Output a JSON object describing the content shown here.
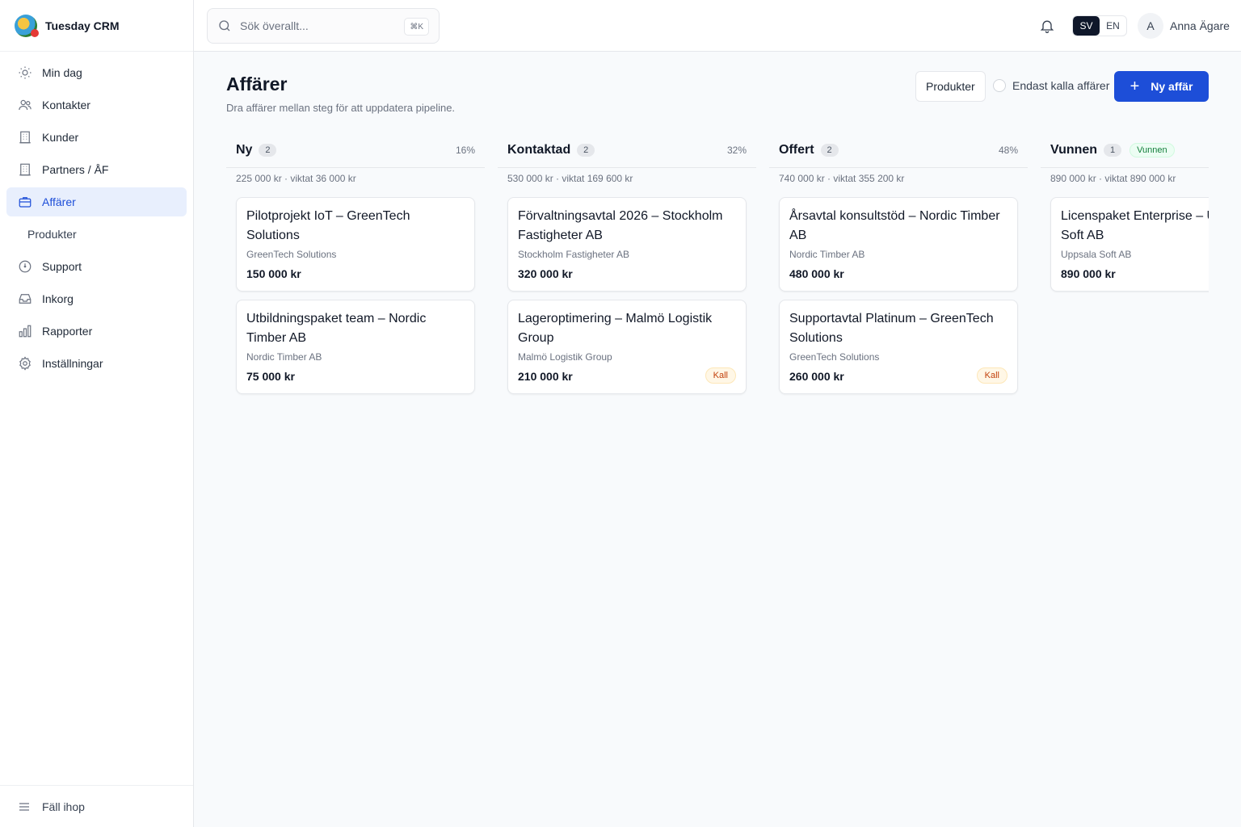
{
  "app": {
    "name": "Tuesday CRM"
  },
  "sidebar": {
    "items": [
      {
        "label": "Min dag"
      },
      {
        "label": "Kontakter"
      },
      {
        "label": "Kunder"
      },
      {
        "label": "Partners / ÅF"
      },
      {
        "label": "Affärer"
      },
      {
        "label": "Produkter"
      },
      {
        "label": "Support"
      },
      {
        "label": "Inkorg"
      },
      {
        "label": "Rapporter"
      },
      {
        "label": "Inställningar"
      }
    ],
    "collapse_label": "Fäll ihop"
  },
  "topbar": {
    "search_placeholder": "Sök överallt...",
    "search_shortcut": "⌘K",
    "lang_sv": "SV",
    "lang_en": "EN",
    "user_initial": "A",
    "user_name": "Anna Ägare"
  },
  "page": {
    "title": "Affärer",
    "subtitle": "Dra affärer mellan steg för att uppdatera pipeline.",
    "products_button": "Produkter",
    "cold_toggle_label": "Endast kalla affärer",
    "new_button": "Ny affär"
  },
  "columns": [
    {
      "name": "Ny",
      "count": "2",
      "percent": "16%",
      "summary": "225 000 kr · viktat 36 000 kr",
      "cards": [
        {
          "title": "Pilotprojekt IoT – GreenTech Solutions",
          "company": "GreenTech Solutions",
          "amount": "150 000 kr"
        },
        {
          "title": "Utbildningspaket team – Nordic Timber AB",
          "company": "Nordic Timber AB",
          "amount": "75 000 kr"
        }
      ]
    },
    {
      "name": "Kontaktad",
      "count": "2",
      "percent": "32%",
      "summary": "530 000 kr · viktat 169 600 kr",
      "cards": [
        {
          "title": "Förvaltningsavtal 2026 – Stockholm Fastigheter AB",
          "company": "Stockholm Fastigheter AB",
          "amount": "320 000 kr"
        },
        {
          "title": "Lageroptimering – Malmö Logistik Group",
          "company": "Malmö Logistik Group",
          "amount": "210 000 kr",
          "tag": "Kall"
        }
      ]
    },
    {
      "name": "Offert",
      "count": "2",
      "percent": "48%",
      "summary": "740 000 kr · viktat 355 200 kr",
      "cards": [
        {
          "title": "Årsavtal konsultstöd – Nordic Timber AB",
          "company": "Nordic Timber AB",
          "amount": "480 000 kr"
        },
        {
          "title": "Supportavtal Platinum – GreenTech Solutions",
          "company": "GreenTech Solutions",
          "amount": "260 000 kr",
          "tag": "Kall"
        }
      ]
    },
    {
      "name": "Vunnen",
      "count": "1",
      "badge": "Vunnen",
      "summary": "890 000 kr · viktat 890 000 kr",
      "cards": [
        {
          "title": "Licenspaket Enterprise – Uppsala Soft AB",
          "company": "Uppsala Soft AB",
          "amount": "890 000 kr"
        }
      ]
    }
  ],
  "colors": {
    "accent": "#1d4ed8",
    "active_nav_bg": "#e8effd",
    "won": "#15803d",
    "cold": "#c2410c"
  }
}
